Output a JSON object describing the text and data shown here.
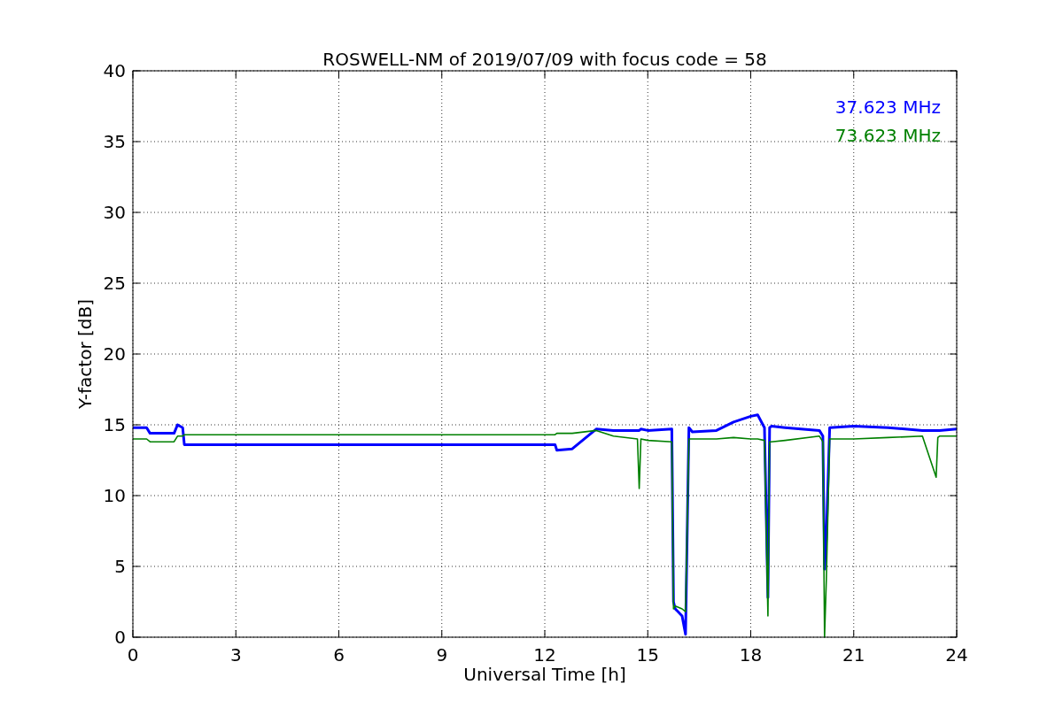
{
  "figure": {
    "chart_data": {
      "type": "line",
      "title": "ROSWELL-NM of 2019/07/09 with focus code = 58",
      "xlabel": "Universal Time [h]",
      "ylabel": "Y-factor [dB]",
      "x": [
        0,
        0.4,
        0.5,
        1.2,
        1.3,
        1.45,
        1.5,
        12.3,
        12.35,
        12.8,
        13.5,
        14,
        14.7,
        14.75,
        14.8,
        15,
        15.7,
        15.75,
        15.8,
        16.0,
        16.1,
        16.2,
        16.3,
        17,
        17.5,
        18,
        18.2,
        18.4,
        18.5,
        18.55,
        18.6,
        19,
        20,
        20.1,
        20.15,
        20.2,
        20.3,
        21,
        22,
        23,
        23.4,
        23.45,
        23.5,
        24
      ],
      "series": [
        {
          "name": "37.623 MHz",
          "color": "#0000ff",
          "values": [
            14.8,
            14.8,
            14.4,
            14.4,
            15.0,
            14.8,
            13.6,
            13.6,
            13.2,
            13.3,
            14.7,
            14.6,
            14.6,
            14.6,
            14.7,
            14.6,
            14.7,
            2.5,
            2.0,
            1.5,
            0.2,
            14.8,
            14.5,
            14.6,
            15.2,
            15.6,
            15.7,
            14.8,
            2.8,
            14.8,
            14.9,
            14.8,
            14.6,
            14.2,
            4.8,
            7,
            14.8,
            14.9,
            14.8,
            14.6,
            14.6,
            14.6,
            14.6,
            14.7
          ]
        },
        {
          "name": "73.623 MHz",
          "color": "#008000",
          "values": [
            14.0,
            14.0,
            13.8,
            13.8,
            14.2,
            14.2,
            14.3,
            14.3,
            14.4,
            14.4,
            14.6,
            14.2,
            14.0,
            10.5,
            14,
            13.9,
            13.8,
            2.0,
            2.2,
            2.0,
            1.8,
            14.0,
            14.0,
            14.0,
            14.1,
            14.0,
            14.0,
            13.9,
            1.5,
            13.8,
            13.8,
            13.9,
            14.2,
            13.8,
            0,
            4,
            14.0,
            14.0,
            14.1,
            14.2,
            11.3,
            14.1,
            14.2,
            14.2
          ]
        }
      ],
      "grid": true,
      "xlim": [
        0,
        24
      ],
      "ylim": [
        0,
        40
      ],
      "xticks": [
        0,
        3,
        6,
        9,
        12,
        15,
        18,
        21,
        24
      ],
      "yticks": [
        0,
        5,
        10,
        15,
        20,
        25,
        30,
        35,
        40
      ]
    }
  }
}
